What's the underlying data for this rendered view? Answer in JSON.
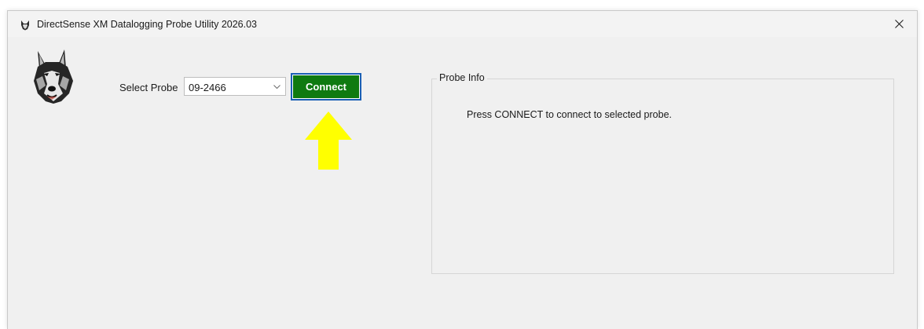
{
  "window": {
    "title": "DirectSense XM Datalogging Probe Utility 2026.03",
    "close_glyph": "close-icon",
    "app_icon": "wolf-icon"
  },
  "probe": {
    "label": "Select Probe",
    "selected": "09-2466",
    "dropdown_icon": "chevron-down-icon"
  },
  "connect_button": {
    "label": "Connect",
    "color": "#0f7a10",
    "focus_color": "#1a5fb4"
  },
  "annotation": {
    "icon": "arrow-up-icon",
    "color": "#ffff00"
  },
  "probe_info": {
    "legend": "Probe Info",
    "message": "Press CONNECT to connect to selected probe."
  }
}
